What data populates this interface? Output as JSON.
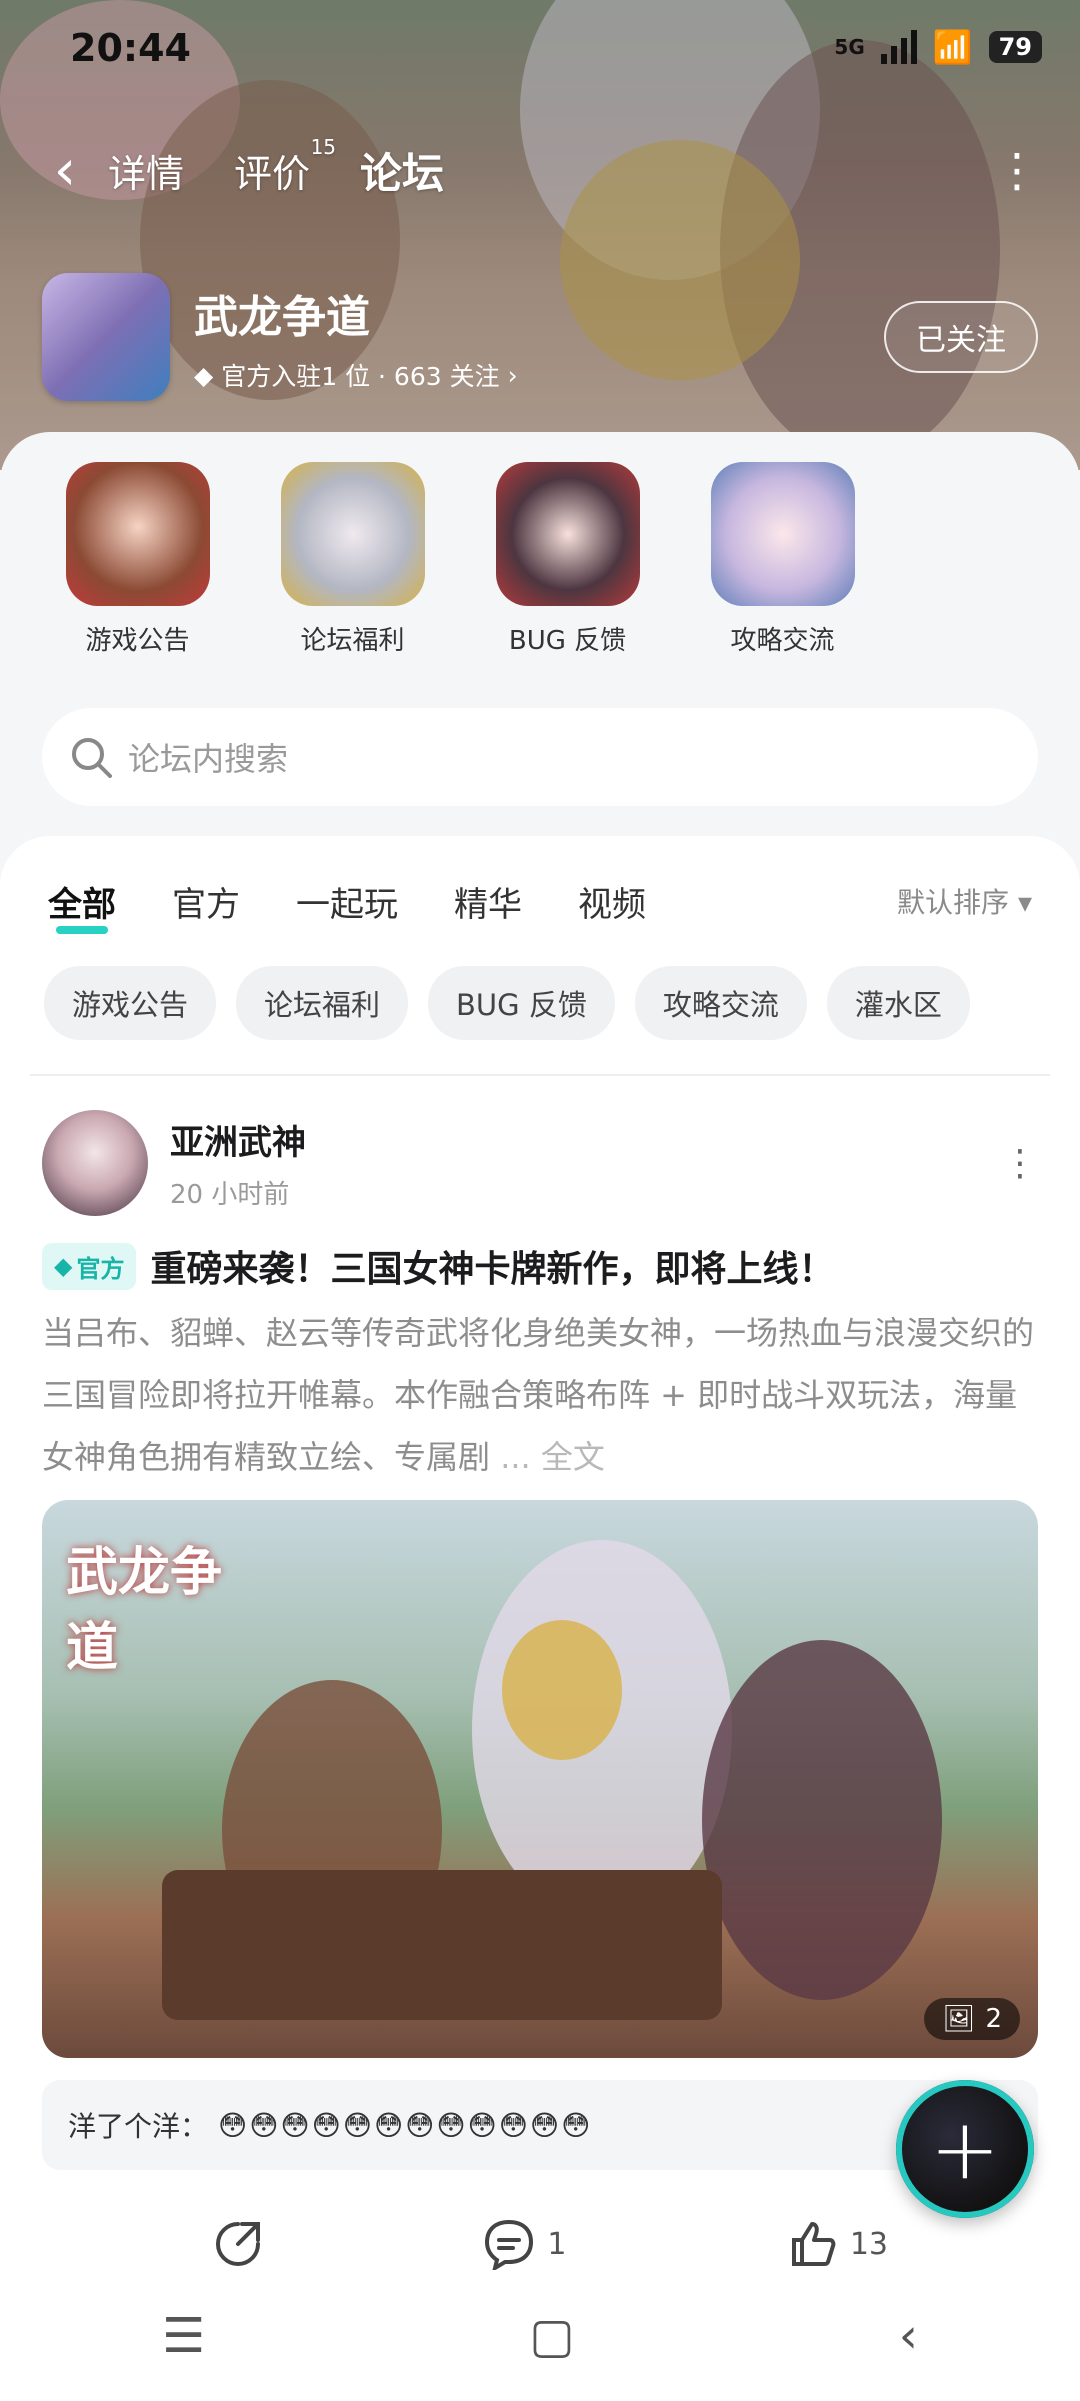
{
  "status": {
    "time": "20:44",
    "network": "5G",
    "battery": "79"
  },
  "nav": {
    "tabs": [
      {
        "label": "详情"
      },
      {
        "label": "评价",
        "badge": "15"
      },
      {
        "label": "论坛"
      }
    ]
  },
  "game": {
    "name": "武龙争道",
    "meta": "官方入驻1 位 · 663 关注",
    "follow_label": "已关注"
  },
  "shortcuts": [
    "游戏公告",
    "论坛福利",
    "BUG 反馈",
    "攻略交流"
  ],
  "search": {
    "placeholder": "论坛内搜索"
  },
  "filters": {
    "tabs": [
      "全部",
      "官方",
      "一起玩",
      "精华",
      "视频"
    ],
    "sort_label": "默认排序",
    "chips": [
      "游戏公告",
      "论坛福利",
      "BUG 反馈",
      "攻略交流",
      "灌水区"
    ]
  },
  "post": {
    "author": "亚洲武神",
    "time": "20 小时前",
    "badge": "官方",
    "title": "重磅来袭！三国女神卡牌新作，即将上线！",
    "body": "当吕布、貂蝉、赵云等传奇武将化身绝美女神，一场热血与浪漫交织的三国冒险即将拉开帷幕。本作融合策略布阵 + 即时战斗双玩法，海量女神角色拥有精致立绘、专属剧",
    "full_label": "... 全文",
    "image_logo": "武龙争道",
    "image_count": "2",
    "comment_user": "洋了个洋：",
    "comment_text": "😳😳😳😳😳😳😳😳😳😳😳😳",
    "comments": "1",
    "likes": "13"
  },
  "colors": {
    "accent": "#27d1c4"
  }
}
